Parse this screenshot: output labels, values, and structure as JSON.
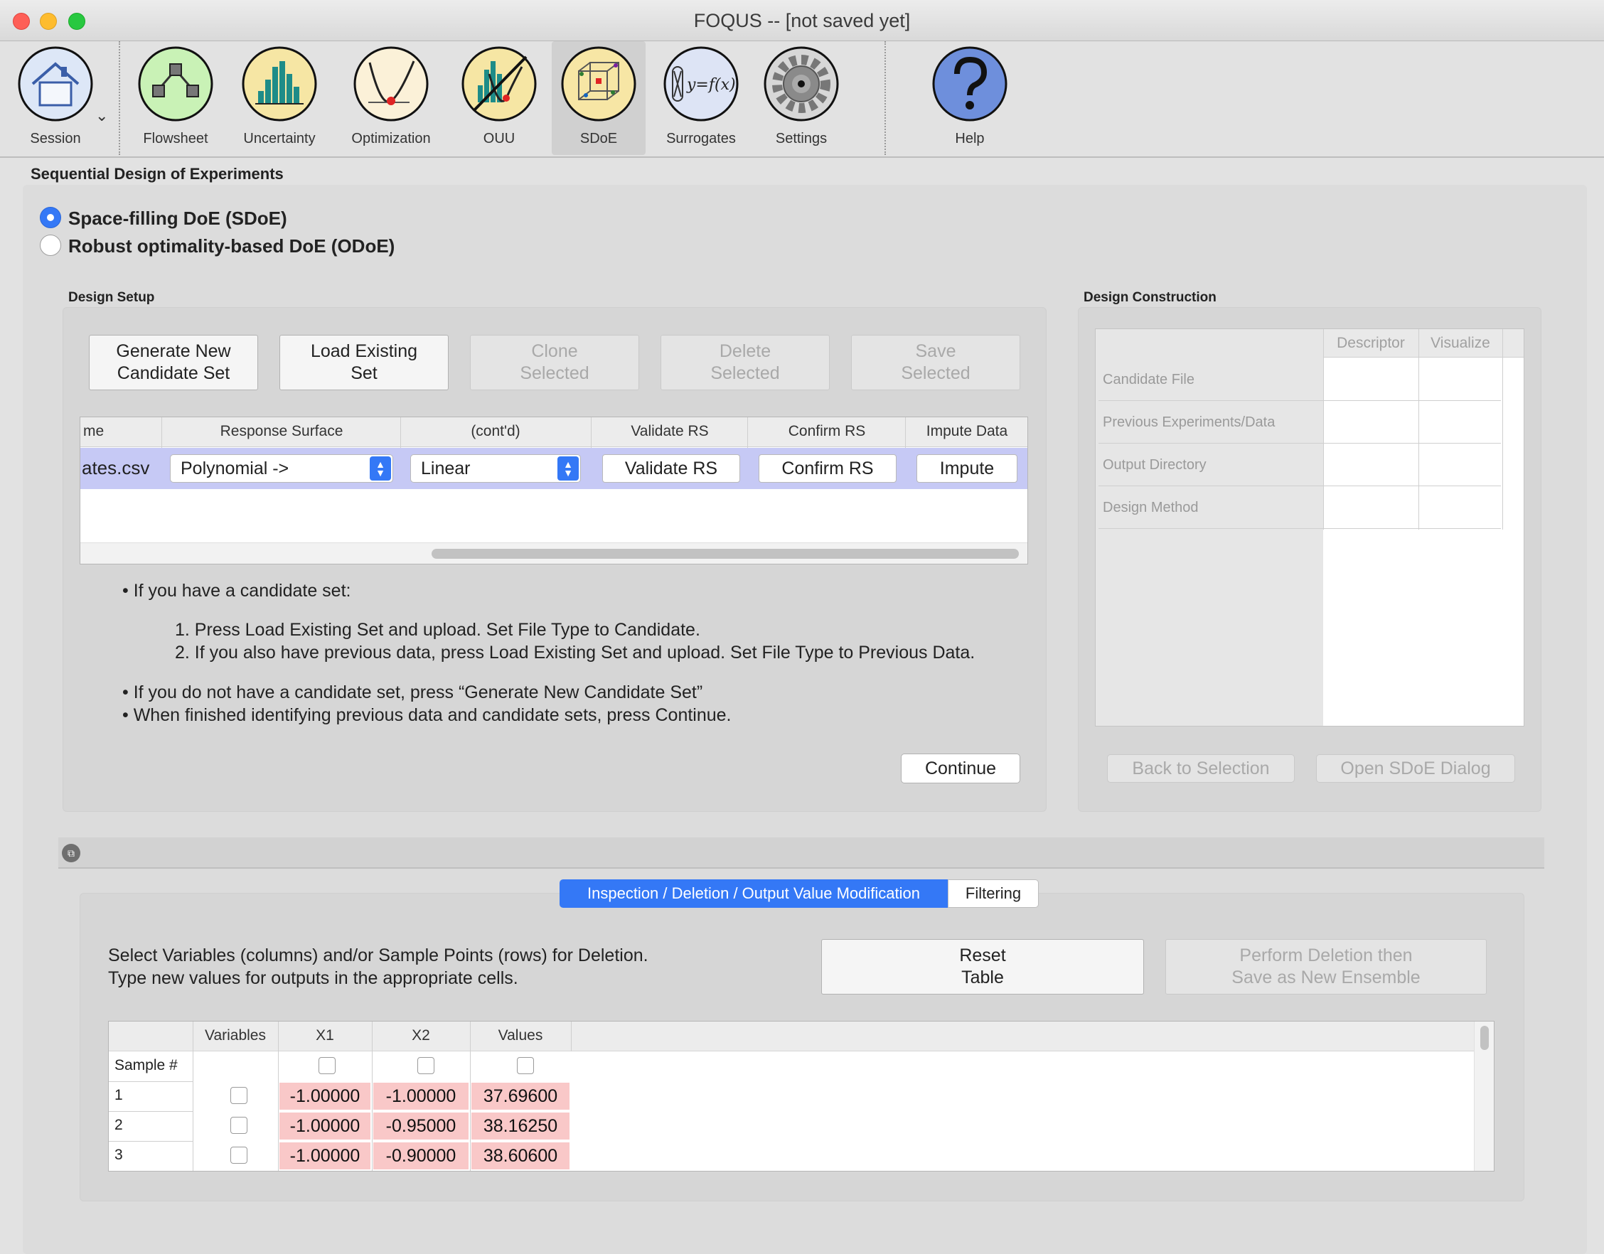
{
  "window": {
    "title": "FOQUS -- [not saved yet]"
  },
  "toolbar": {
    "items": [
      {
        "label": "Session",
        "icon": "house-icon"
      },
      {
        "label": "Flowsheet",
        "icon": "flowsheet-graph-icon"
      },
      {
        "label": "Uncertainty",
        "icon": "histogram-icon"
      },
      {
        "label": "Optimization",
        "icon": "optimization-curve-icon"
      },
      {
        "label": "OUU",
        "icon": "ouu-icon"
      },
      {
        "label": "SDoE",
        "icon": "sdoe-cube-icon"
      },
      {
        "label": "Surrogates",
        "icon": "surrogate-function-icon"
      },
      {
        "label": "Settings",
        "icon": "gear-icon"
      },
      {
        "label": "Help",
        "icon": "help-question-icon"
      }
    ],
    "active": "SDoE",
    "surrogate_icon_text": "y=f(x)"
  },
  "main": {
    "section_title": "Sequential Design of Experiments",
    "radio_sdoe": "Space-filling DoE (SDoE)",
    "radio_odoe": "Robust optimality-based DoE (ODoE)",
    "selected_mode": "sdoe"
  },
  "design_setup": {
    "title": "Design Setup",
    "buttons": {
      "generate": "Generate New\nCandidate Set",
      "load": "Load Existing\nSet",
      "clone": "Clone\nSelected",
      "delete": "Delete\nSelected",
      "save": "Save\nSelected"
    },
    "table": {
      "headers": [
        "me",
        "Response Surface",
        "(cont'd)",
        "Validate RS",
        "Confirm RS",
        "Impute Data"
      ],
      "row": {
        "name": "ates.csv",
        "response_surface": "Polynomial ->",
        "contd": "Linear",
        "validate": "Validate RS",
        "confirm": "Confirm RS",
        "impute": "Impute"
      }
    },
    "instructions": {
      "b1": "If you have a candidate set:",
      "s1": "Press Load Existing Set and upload. Set File Type to Candidate.",
      "s2": "If you also have previous data, press Load Existing Set and upload. Set File Type to Previous Data.",
      "b2": "If you do not have a candidate set, press “Generate New Candidate Set”",
      "b3": "When finished identifying previous data and candidate sets, press Continue."
    },
    "continue": "Continue"
  },
  "design_construction": {
    "title": "Design Construction",
    "headers": [
      "Descriptor",
      "Visualize"
    ],
    "rows": [
      "Candidate File",
      "Previous Experiments/Data",
      "Output Directory",
      "Design Method"
    ],
    "back": "Back to Selection",
    "open": "Open SDoE Dialog"
  },
  "inspection": {
    "tabs": [
      "Inspection / Deletion / Output Value Modification",
      "Filtering"
    ],
    "active_tab": 0,
    "line1": "Select Variables (columns) and/or Sample Points (rows) for Deletion.",
    "line2": "Type new values for outputs in the appropriate cells.",
    "reset": "Reset\nTable",
    "perform": "Perform Deletion then\nSave as New Ensemble",
    "table": {
      "headers": [
        "Variables",
        "X1",
        "X2",
        "Values"
      ],
      "sample_label": "Sample #",
      "rows": [
        {
          "n": "1",
          "x1": "-1.00000",
          "x2": "-1.00000",
          "v": "37.69600"
        },
        {
          "n": "2",
          "x1": "-1.00000",
          "x2": "-0.95000",
          "v": "38.16250"
        },
        {
          "n": "3",
          "x1": "-1.00000",
          "x2": "-0.90000",
          "v": "38.60600"
        }
      ]
    }
  },
  "colors": {
    "accent": "#3478f6",
    "row_highlight": "#c6c9f5",
    "pink_cell": "#f9c8c8"
  }
}
